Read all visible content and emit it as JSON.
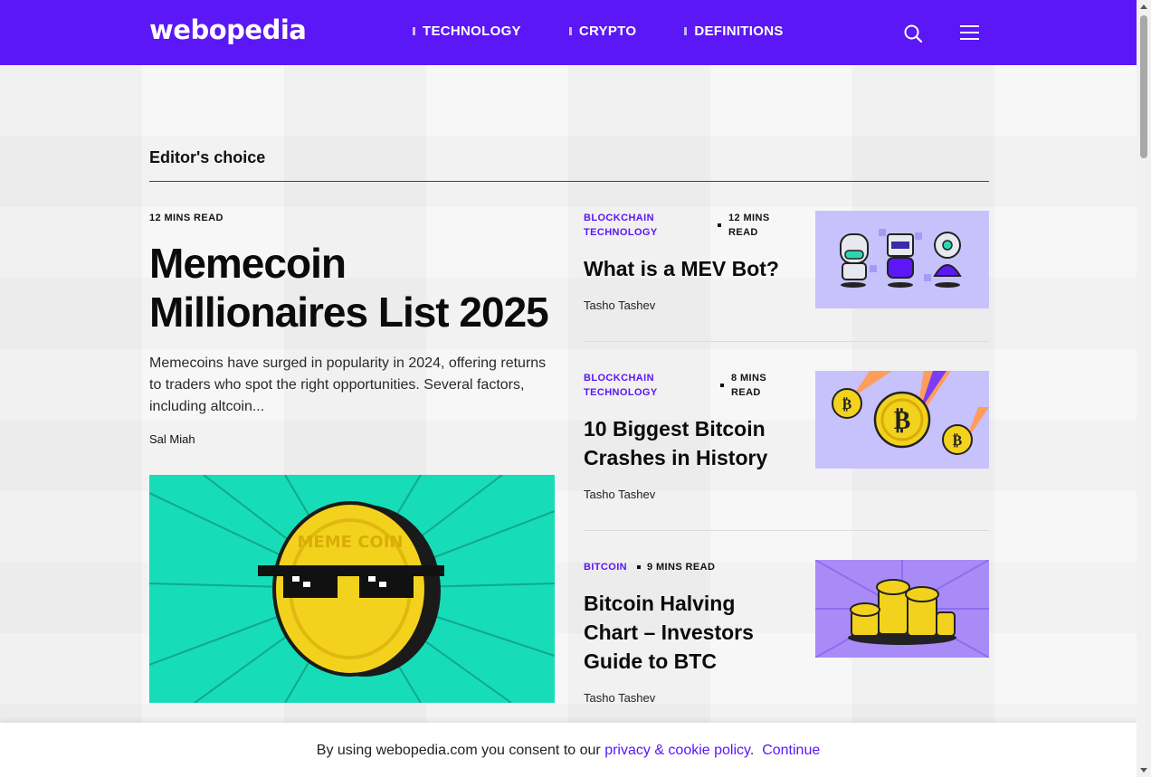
{
  "brand": {
    "logo_text": "webopedia",
    "accent": "#5b17f5"
  },
  "nav": {
    "items": [
      {
        "label": "TECHNOLOGY"
      },
      {
        "label": "CRYPTO"
      },
      {
        "label": "DEFINITIONS"
      }
    ],
    "icons": [
      "search-icon",
      "menu-icon"
    ]
  },
  "section": {
    "title": "Editor's choice"
  },
  "featured": {
    "read_time": "12 MINS READ",
    "title": "Memecoin Millionaires List 2025",
    "excerpt": "Memecoins have surged in popularity in 2024, offering returns to traders who spot the right opportunities. Several factors, including altcoin...",
    "author": "Sal Miah",
    "image_text": "MEME COIN"
  },
  "articles": [
    {
      "category_line1": "BLOCKCHAIN",
      "category_line2": "TECHNOLOGY",
      "read_line1": "12 MINS",
      "read_line2": "READ",
      "title": "What is a MEV Bot?",
      "author": "Tasho Tashev"
    },
    {
      "category_line1": "BLOCKCHAIN",
      "category_line2": "TECHNOLOGY",
      "read_line1": "8 MINS",
      "read_line2": "READ",
      "title": "10 Biggest Bitcoin Crashes in History",
      "author": "Tasho Tashev"
    },
    {
      "category_line1": "BITCOIN",
      "read_line1": "9 MINS READ",
      "title": "Bitcoin Halving Chart – Investors Guide to BTC",
      "author": "Tasho Tashev"
    }
  ],
  "consent": {
    "prefix": "By using webopedia.com you consent to our ",
    "policy_link": "privacy & cookie policy",
    "suffix": ".",
    "continue_label": "Continue"
  }
}
